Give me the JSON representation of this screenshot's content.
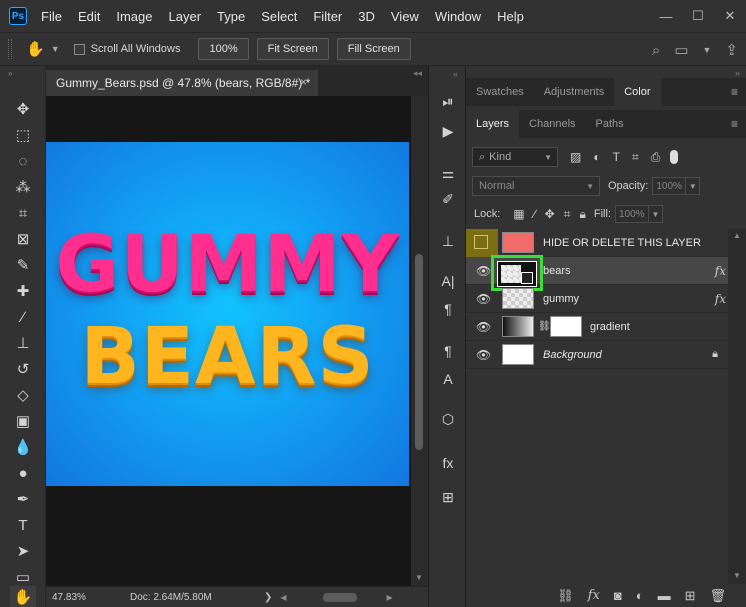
{
  "app": {
    "logo": "Ps"
  },
  "menu": [
    "File",
    "Edit",
    "Image",
    "Layer",
    "Type",
    "Select",
    "Filter",
    "3D",
    "View",
    "Window",
    "Help"
  ],
  "window_controls": {
    "minimize": "—",
    "restore": "☐",
    "close": "✕"
  },
  "options": {
    "scroll_all": "Scroll All Windows",
    "zoom_btn": "100%",
    "fit_btn": "Fit Screen",
    "fill_btn": "Fill Screen"
  },
  "document": {
    "tab_title": "Gummy_Bears.psd @ 47.8% (bears, RGB/8#) *",
    "close": "×",
    "artwork": {
      "line1": "GUMMY",
      "line2": "BEARS"
    }
  },
  "status": {
    "zoom": "47.83%",
    "doc": "Doc: 2.64M/5.80M",
    "arrow": "❯"
  },
  "panel_tabs_top": [
    {
      "label": "Swatches",
      "active": false
    },
    {
      "label": "Adjustments",
      "active": false
    },
    {
      "label": "Color",
      "active": true
    }
  ],
  "panel_tabs_layers": [
    {
      "label": "Layers",
      "active": true
    },
    {
      "label": "Channels",
      "active": false
    },
    {
      "label": "Paths",
      "active": false
    }
  ],
  "filter": {
    "kind_label": "Kind"
  },
  "blend": {
    "mode": "Normal",
    "opacity_label": "Opacity:",
    "opacity_value": "100%"
  },
  "lock": {
    "label": "Lock:",
    "fill_label": "Fill:",
    "fill_value": "100%"
  },
  "layers": [
    {
      "name": "HIDE OR DELETE THIS LAYER",
      "visible": false,
      "thumb": "red"
    },
    {
      "name": "bears",
      "visible": true,
      "selected": true,
      "fx": "fx",
      "thumb": "smart"
    },
    {
      "name": "gummy",
      "visible": true,
      "fx": "fx",
      "thumb": "check"
    },
    {
      "name": "gradient",
      "visible": true,
      "thumb": "gradient",
      "mask": true
    },
    {
      "name": "Background",
      "visible": true,
      "locked": true,
      "thumb": "white"
    }
  ],
  "colors": {
    "highlight": "#3ddc3d",
    "canvas_bg": "#12a5f5",
    "gummy_text": "#ff2e8f",
    "bears_text": "#ffb51d"
  }
}
